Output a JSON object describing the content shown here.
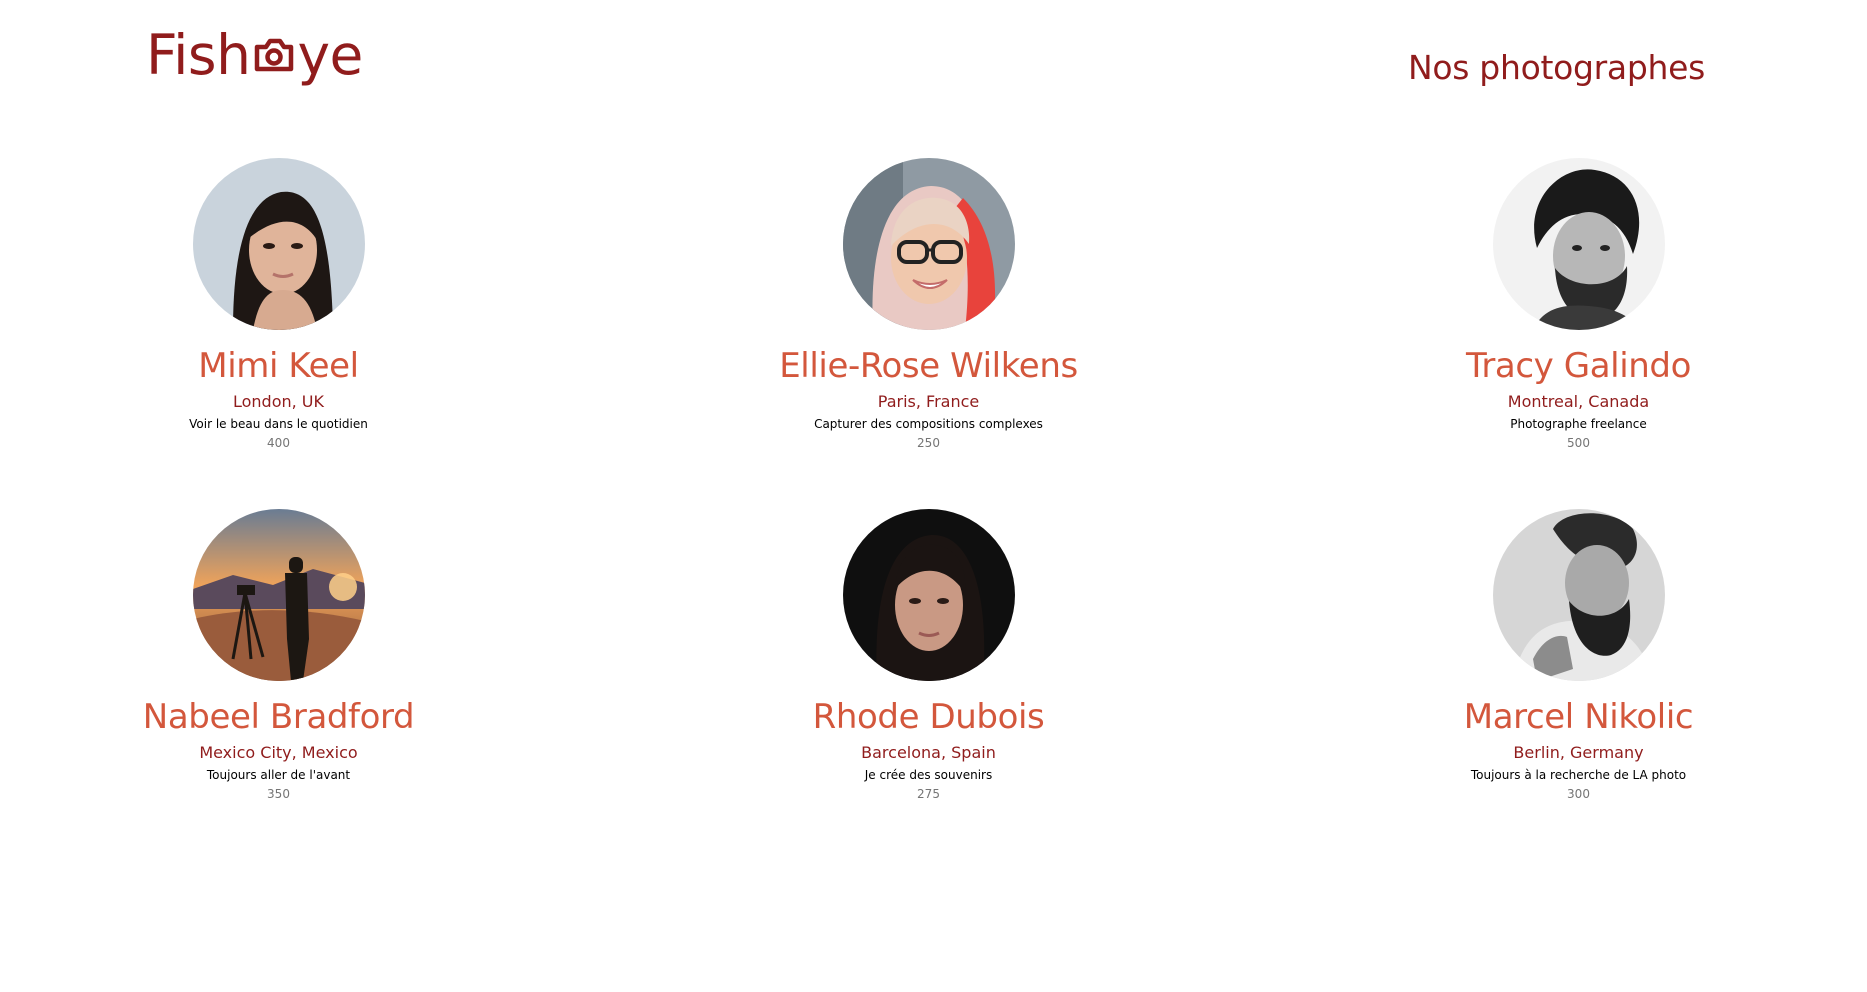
{
  "header": {
    "logo_prefix": "Fish",
    "logo_suffix": "ye",
    "heading": "Nos photographes"
  },
  "colors": {
    "primary": "#901C1C",
    "secondary": "#D3573C",
    "muted": "#757575"
  },
  "photographers": [
    {
      "name": "Mimi Keel",
      "location": "London, UK",
      "tagline": "Voir le beau dans le quotidien",
      "price": "400"
    },
    {
      "name": "Ellie-Rose Wilkens",
      "location": "Paris, France",
      "tagline": "Capturer des compositions complexes",
      "price": "250"
    },
    {
      "name": "Tracy Galindo",
      "location": "Montreal, Canada",
      "tagline": "Photographe freelance",
      "price": "500"
    },
    {
      "name": "Nabeel Bradford",
      "location": "Mexico City, Mexico",
      "tagline": "Toujours aller de l'avant",
      "price": "350"
    },
    {
      "name": "Rhode Dubois",
      "location": "Barcelona, Spain",
      "tagline": "Je crée des souvenirs",
      "price": "275"
    },
    {
      "name": "Marcel Nikolic",
      "location": "Berlin, Germany",
      "tagline": "Toujours à la recherche de LA photo",
      "price": "300"
    }
  ]
}
